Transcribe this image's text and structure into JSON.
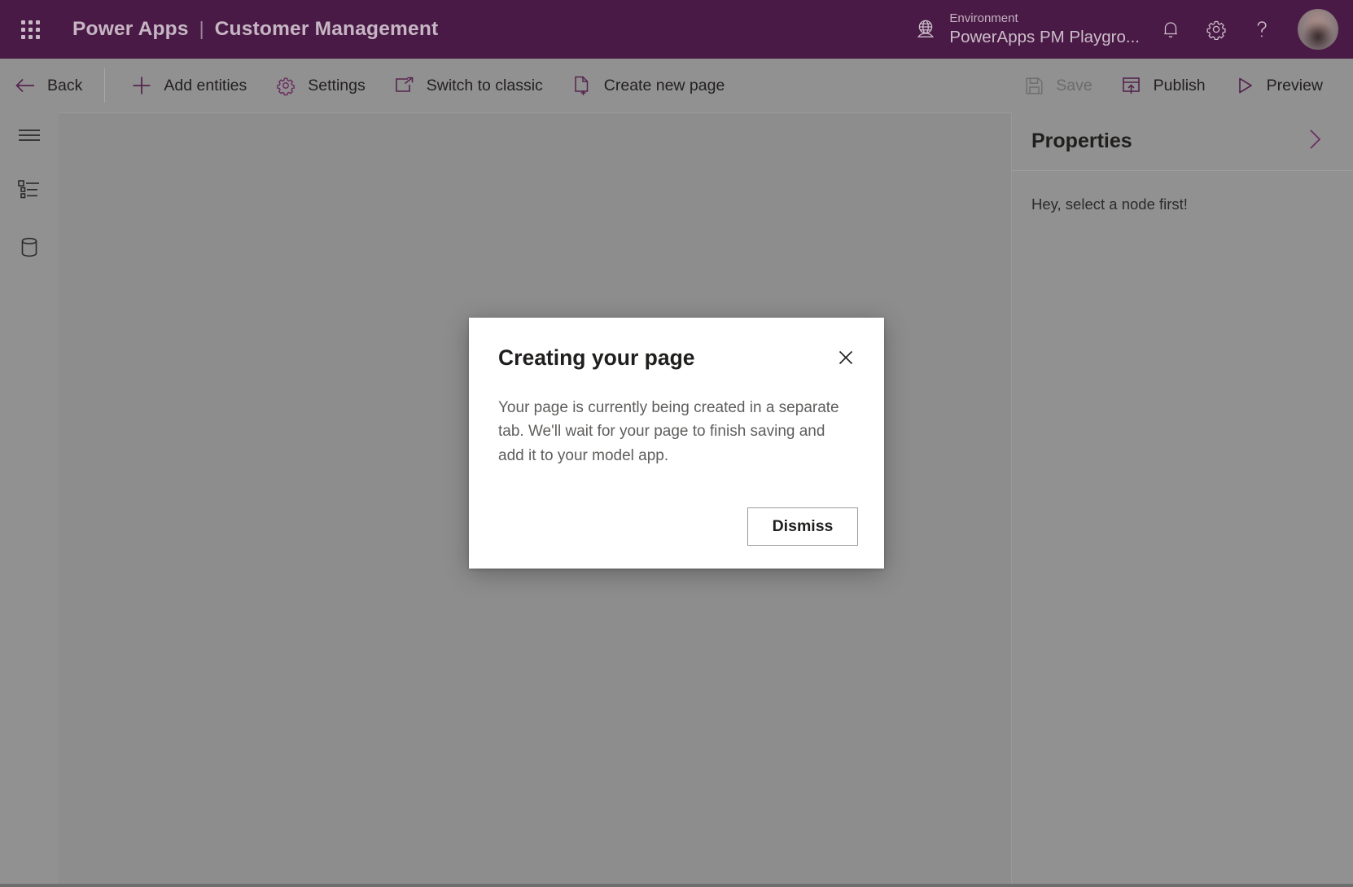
{
  "header": {
    "waffle_label": "app-launcher",
    "brand_name": "Power Apps",
    "brand_separator": "|",
    "app_name": "Customer Management",
    "environment_label": "Environment",
    "environment_value": "PowerApps PM Playgro...",
    "globe_icon": "globe-icon",
    "notifications_icon": "bell-icon",
    "settings_icon": "gear-icon",
    "help_icon": "question-mark-icon",
    "avatar_icon": "user-avatar",
    "background_color": "#4a1a46",
    "text_color": "#c6b6c4"
  },
  "command_bar": {
    "accent_color": "#5c2150",
    "left_items": [
      {
        "label": "Back",
        "icon": "arrow-left-icon",
        "disabled": false
      },
      {
        "label": "Add entities",
        "icon": "plus-icon",
        "disabled": false
      },
      {
        "label": "Settings",
        "icon": "gear-icon",
        "disabled": false
      },
      {
        "label": "Switch to classic",
        "icon": "open-in-new-icon",
        "disabled": false
      },
      {
        "label": "Create new page",
        "icon": "page-add-icon",
        "disabled": false
      }
    ],
    "right_items": [
      {
        "label": "Save",
        "icon": "save-icon",
        "disabled": true
      },
      {
        "label": "Publish",
        "icon": "publish-icon",
        "disabled": false
      },
      {
        "label": "Preview",
        "icon": "play-icon",
        "disabled": false
      }
    ]
  },
  "left_rail": {
    "items": [
      {
        "name": "menu-icon",
        "title": "Menu"
      },
      {
        "name": "site-map-tree-icon",
        "title": "Site map"
      },
      {
        "name": "database-icon",
        "title": "Data"
      }
    ]
  },
  "properties_panel": {
    "title": "Properties",
    "collapse_icon": "chevron-right-icon",
    "empty_message": "Hey, select a node first!"
  },
  "dialog": {
    "title": "Creating your page",
    "close_icon": "close-icon",
    "body": "Your page is currently being created in a separate tab. We'll wait for your page to finish saving and add it to your model app.",
    "dismiss_label": "Dismiss"
  }
}
